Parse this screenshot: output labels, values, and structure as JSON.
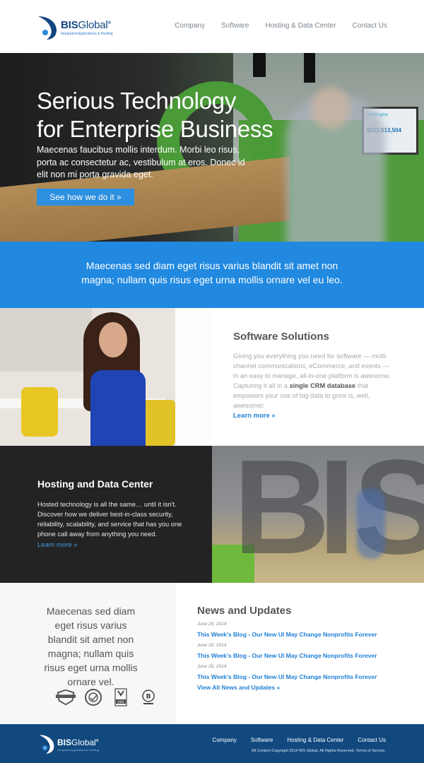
{
  "brand": {
    "name_bold": "BIS",
    "name_light": "Global",
    "reg": "®",
    "tagline": "Integrated Applications & Hosting"
  },
  "nav": {
    "items": [
      {
        "label": "Company"
      },
      {
        "label": "Software"
      },
      {
        "label": "Hosting & Data Center"
      },
      {
        "label": "Contact Us"
      }
    ]
  },
  "hero": {
    "title_line1": "Serious Technology",
    "title_line2": "for Enterprise Business",
    "subtitle": "Maecenas faucibus mollis interdum. Morbi leo risus, porta ac consectetur ac, vestibulum at eros. Donec id elit non mi porta gravida eget.",
    "button_label": "See how we do it »",
    "screen_brand": "arityEngine",
    "screen_value": "$523,513,504"
  },
  "band": {
    "text": "Maecenas sed diam eget risus varius blandit sit amet non magna; nullam quis risus eget urna mollis ornare vel eu leo."
  },
  "software": {
    "title": "Software Solutions",
    "body_before": "Giving you everything you need for software — multi-channel communications, eCommerce, and events — in an easy to manage, all-in-one platform is awesome. Capturing it all in a ",
    "body_bold": "single CRM database",
    "body_after": " that empowers your use of big data to grow is, well, awesomer.",
    "link_label": "Learn more »"
  },
  "hosting": {
    "title": "Hosting and Data Center",
    "body": "Hosted technology is all the same… until it isn't. Discover how we deliver best-in-class security, reliability, scalability, and service that has you one phone call away from anything you need.",
    "link_label": "Learn more »",
    "letters": [
      "B",
      "I",
      "S"
    ]
  },
  "quote": {
    "text": "Maecenas sed diam eget risus varius blandit sit amet non magna; nullam quis risus eget urna mollis ornare vel.",
    "badges": [
      "shield-badge",
      "seal-badge",
      "bbb-badge",
      "b-corp-badge"
    ],
    "badge_bbb_text": "BBB",
    "badge_bcorp_text": "B"
  },
  "news": {
    "title": "News and Updates",
    "items": [
      {
        "date": "June 20, 2014",
        "title": "This Week's Blog - Our New UI May Change Nonprofits Forever"
      },
      {
        "date": "June 20, 2014",
        "title": "This Week's Blog - Our New UI May Change Nonprofits Forever"
      },
      {
        "date": "June 20, 2014",
        "title": "This Week's Blog - Our New UI May Change Nonprofits Forever"
      }
    ],
    "view_all": "View All News and Updates »"
  },
  "footer": {
    "nav": [
      {
        "label": "Company"
      },
      {
        "label": "Software"
      },
      {
        "label": "Hosting & Data Center"
      },
      {
        "label": "Contact Us"
      }
    ],
    "copyright": "All Content Copyright 2014 BIS Global. All Rights Reserved. Terms of Service."
  },
  "colors": {
    "brand_blue": "#13457f",
    "accent_blue": "#2189e0",
    "footer_blue": "#11497f",
    "dark_panel": "#232323"
  }
}
